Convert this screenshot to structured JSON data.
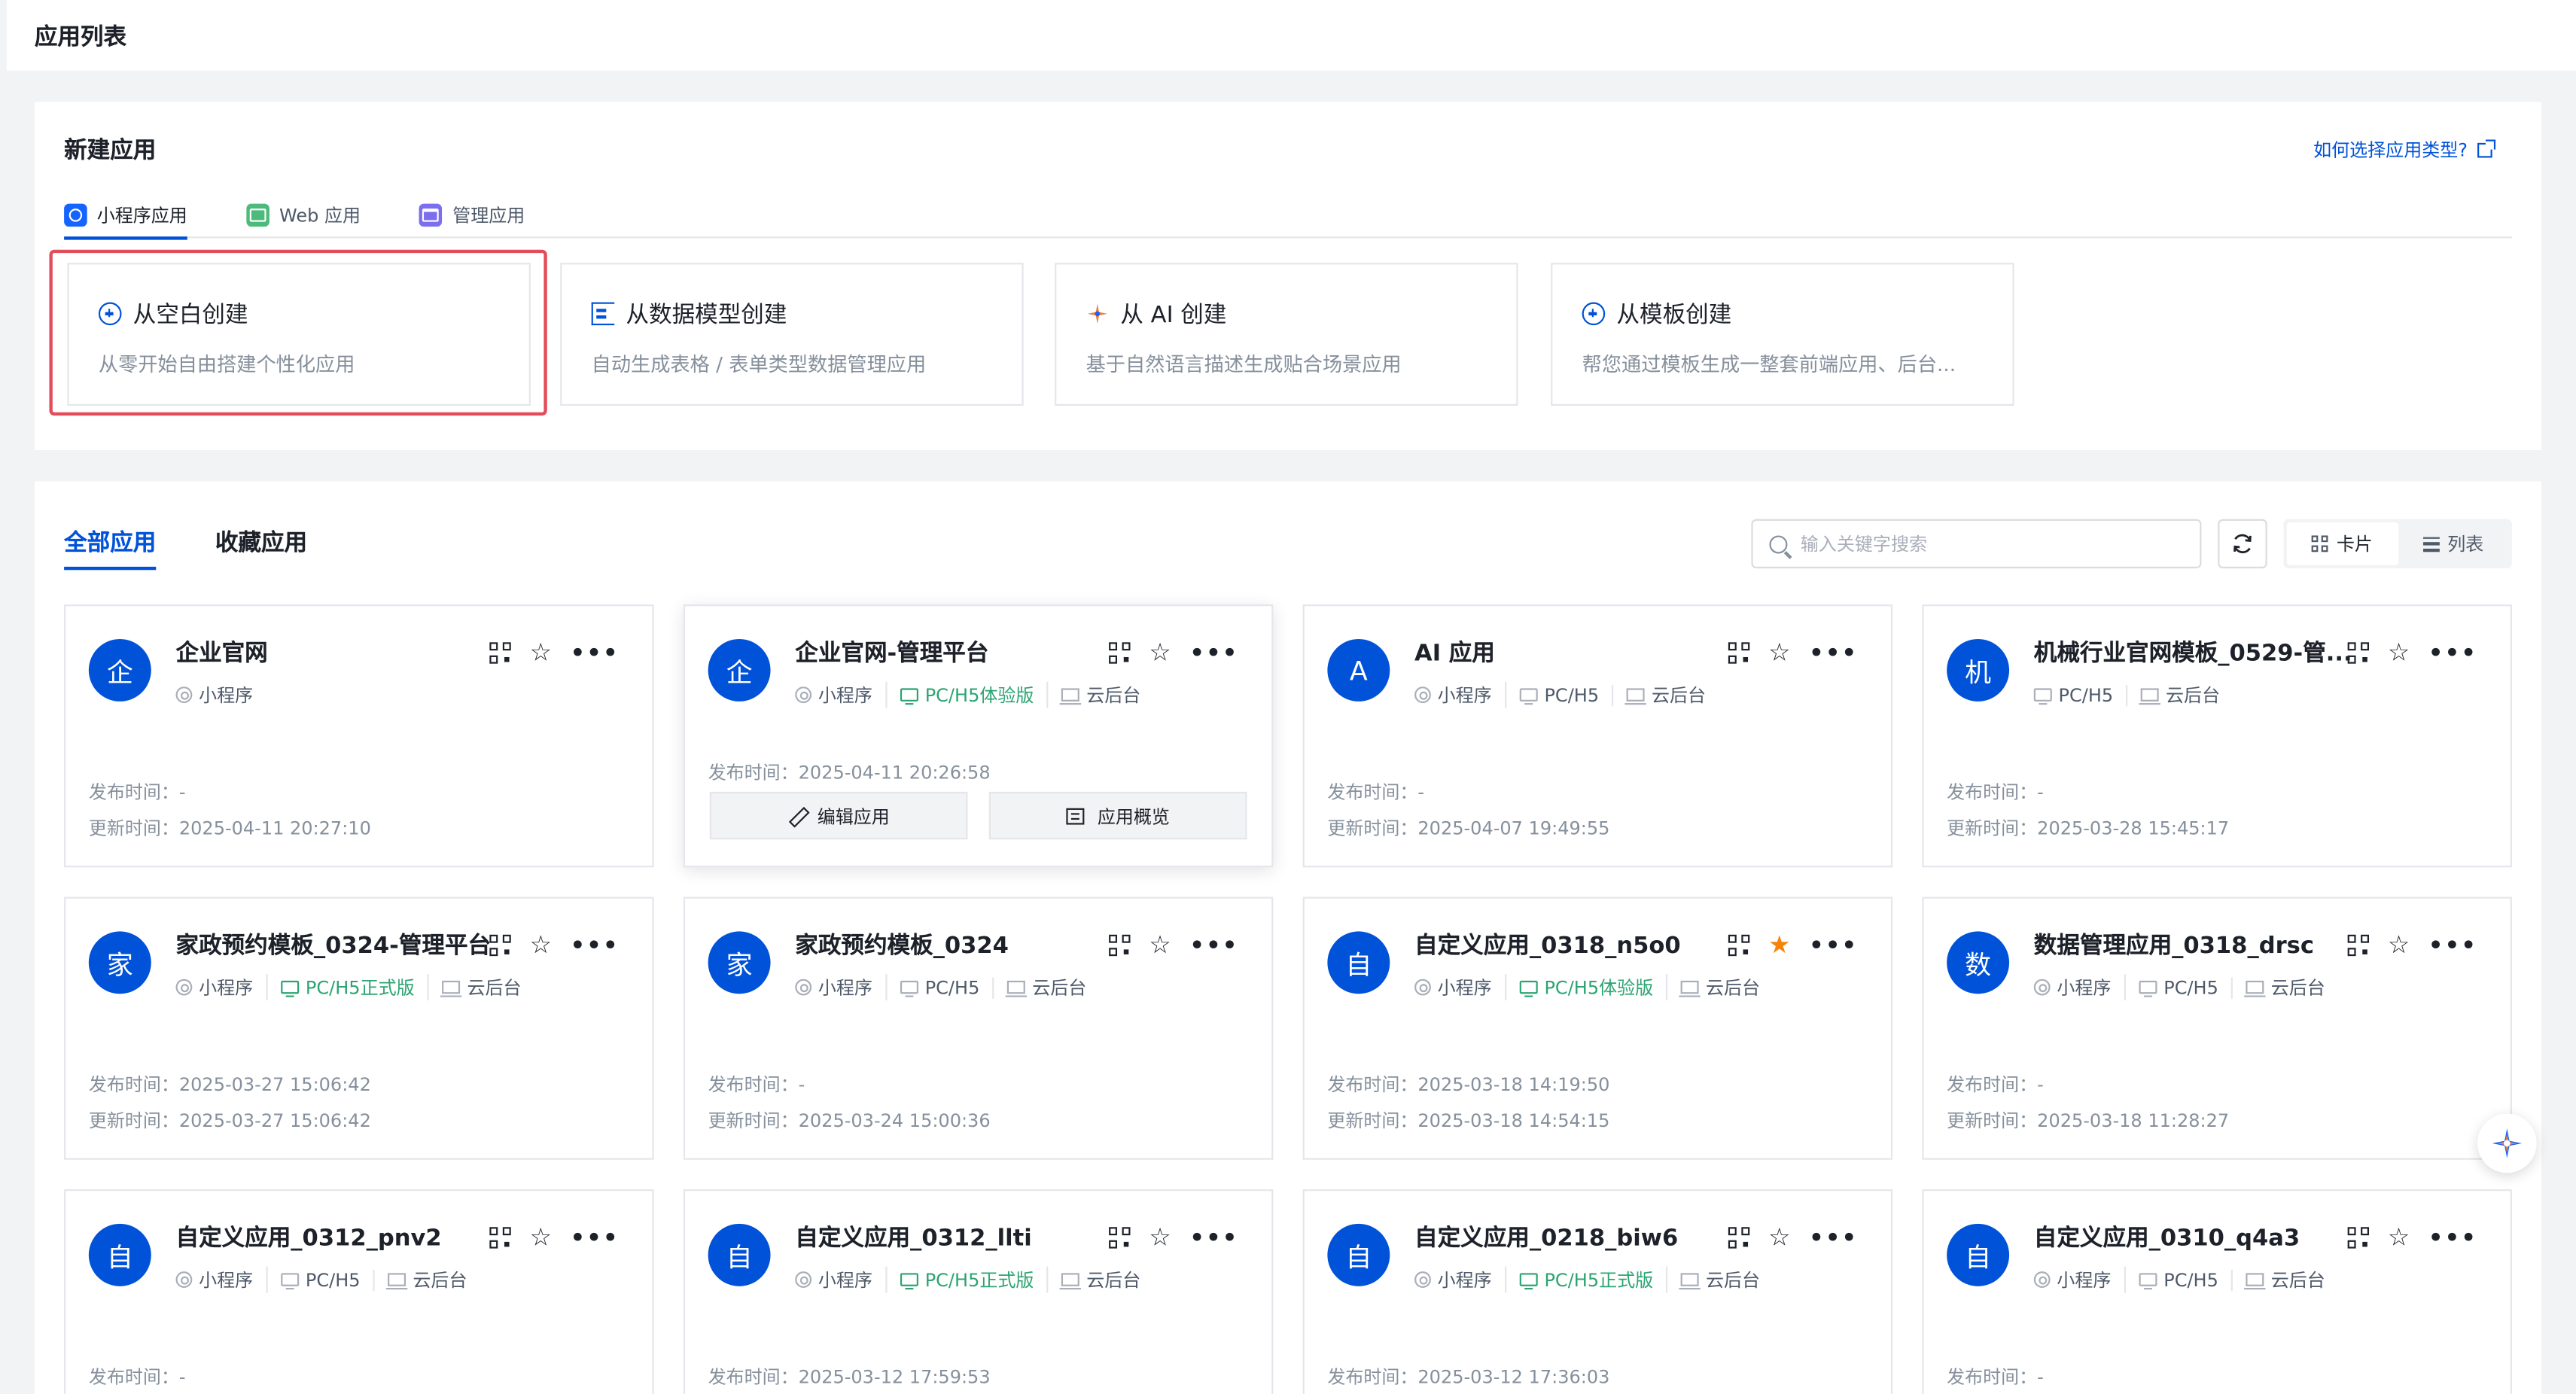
{
  "topbar": {
    "title": "应用列表"
  },
  "new_app": {
    "heading": "新建应用",
    "help_link": "如何选择应用类型?",
    "type_tabs": [
      {
        "label": "小程序应用",
        "icon": "mini-program-icon",
        "active": true
      },
      {
        "label": "Web 应用",
        "icon": "web-app-icon",
        "active": false
      },
      {
        "label": "管理应用",
        "icon": "admin-app-icon",
        "active": false
      }
    ],
    "create_options": [
      {
        "title": "从空白创建",
        "desc": "从零开始自由搭建个性化应用",
        "icon": "plus-circle-icon"
      },
      {
        "title": "从数据模型创建",
        "desc": "自动生成表格 / 表单类型数据管理应用",
        "icon": "data-model-icon"
      },
      {
        "title": "从 AI 创建",
        "desc": "基于自然语言描述生成贴合场景应用",
        "icon": "ai-sparkle-icon"
      },
      {
        "title": "从模板创建",
        "desc": "帮您通过模板生成一整套前端应用、后台...",
        "icon": "plus-circle-icon"
      }
    ]
  },
  "apps": {
    "tabs": [
      {
        "label": "全部应用",
        "active": true
      },
      {
        "label": "收藏应用",
        "active": false
      }
    ],
    "search": {
      "placeholder": "输入关键字搜索",
      "value": ""
    },
    "view": {
      "card_label": "卡片",
      "list_label": "列表",
      "active": "card"
    },
    "labels": {
      "published": "发布时间：",
      "updated": "更新时间：",
      "edit_app": "编辑应用",
      "app_overview": "应用概览"
    },
    "items": [
      {
        "avatar": "企",
        "name": "企业官网",
        "tags": [
          {
            "t": "小程序",
            "i": "mini"
          }
        ],
        "published": "-",
        "updated": "2025-04-11 20:27:10",
        "starred": false,
        "hovered": false
      },
      {
        "avatar": "企",
        "name": "企业官网-管理平台",
        "tags": [
          {
            "t": "小程序",
            "i": "mini"
          },
          {
            "t": "PC/H5体验版",
            "i": "pc",
            "g": true
          },
          {
            "t": "云后台",
            "i": "cloud"
          }
        ],
        "published": "2025-04-11 20:26:58",
        "updated": "",
        "starred": false,
        "hovered": true
      },
      {
        "avatar": "A",
        "name": "AI 应用",
        "tags": [
          {
            "t": "小程序",
            "i": "mini"
          },
          {
            "t": "PC/H5",
            "i": "pc"
          },
          {
            "t": "云后台",
            "i": "cloud"
          }
        ],
        "published": "-",
        "updated": "2025-04-07 19:49:55",
        "starred": false,
        "hovered": false
      },
      {
        "avatar": "机",
        "name": "机械行业官网模板_0529-管...",
        "tags": [
          {
            "t": "PC/H5",
            "i": "pc"
          },
          {
            "t": "云后台",
            "i": "cloud"
          }
        ],
        "published": "-",
        "updated": "2025-03-28 15:45:17",
        "starred": false,
        "hovered": false
      },
      {
        "avatar": "家",
        "name": "家政预约模板_0324-管理平台",
        "tags": [
          {
            "t": "小程序",
            "i": "mini"
          },
          {
            "t": "PC/H5正式版",
            "i": "pc",
            "g": true
          },
          {
            "t": "云后台",
            "i": "cloud"
          }
        ],
        "published": "2025-03-27 15:06:42",
        "updated": "2025-03-27 15:06:42",
        "starred": false,
        "hovered": false
      },
      {
        "avatar": "家",
        "name": "家政预约模板_0324",
        "tags": [
          {
            "t": "小程序",
            "i": "mini"
          },
          {
            "t": "PC/H5",
            "i": "pc"
          },
          {
            "t": "云后台",
            "i": "cloud"
          }
        ],
        "published": "-",
        "updated": "2025-03-24 15:00:36",
        "starred": false,
        "hovered": false
      },
      {
        "avatar": "自",
        "name": "自定义应用_0318_n5o0",
        "tags": [
          {
            "t": "小程序",
            "i": "mini"
          },
          {
            "t": "PC/H5体验版",
            "i": "pc",
            "g": true
          },
          {
            "t": "云后台",
            "i": "cloud"
          }
        ],
        "published": "2025-03-18 14:19:50",
        "updated": "2025-03-18 14:54:15",
        "starred": true,
        "hovered": false
      },
      {
        "avatar": "数",
        "name": "数据管理应用_0318_drsc",
        "tags": [
          {
            "t": "小程序",
            "i": "mini"
          },
          {
            "t": "PC/H5",
            "i": "pc"
          },
          {
            "t": "云后台",
            "i": "cloud"
          }
        ],
        "published": "-",
        "updated": "2025-03-18 11:28:27",
        "starred": false,
        "hovered": false
      },
      {
        "avatar": "自",
        "name": "自定义应用_0312_pnv2",
        "tags": [
          {
            "t": "小程序",
            "i": "mini"
          },
          {
            "t": "PC/H5",
            "i": "pc"
          },
          {
            "t": "云后台",
            "i": "cloud"
          }
        ],
        "published": "-",
        "updated": "",
        "starred": false,
        "hovered": false
      },
      {
        "avatar": "自",
        "name": "自定义应用_0312_llti",
        "tags": [
          {
            "t": "小程序",
            "i": "mini"
          },
          {
            "t": "PC/H5正式版",
            "i": "pc",
            "g": true
          },
          {
            "t": "云后台",
            "i": "cloud"
          }
        ],
        "published": "2025-03-12 17:59:53",
        "updated": "",
        "starred": false,
        "hovered": false
      },
      {
        "avatar": "自",
        "name": "自定义应用_0218_biw6",
        "tags": [
          {
            "t": "小程序",
            "i": "mini"
          },
          {
            "t": "PC/H5正式版",
            "i": "pc",
            "g": true
          },
          {
            "t": "云后台",
            "i": "cloud"
          }
        ],
        "published": "2025-03-12 17:36:03",
        "updated": "",
        "starred": false,
        "hovered": false
      },
      {
        "avatar": "自",
        "name": "自定义应用_0310_q4a3",
        "tags": [
          {
            "t": "小程序",
            "i": "mini"
          },
          {
            "t": "PC/H5",
            "i": "pc"
          },
          {
            "t": "云后台",
            "i": "cloud"
          }
        ],
        "published": "-",
        "updated": "",
        "starred": false,
        "hovered": false
      }
    ]
  },
  "colors": {
    "brand": "#0052d9",
    "success": "#2ba471",
    "star_active": "#f7830a",
    "highlight": "#e34d59"
  }
}
